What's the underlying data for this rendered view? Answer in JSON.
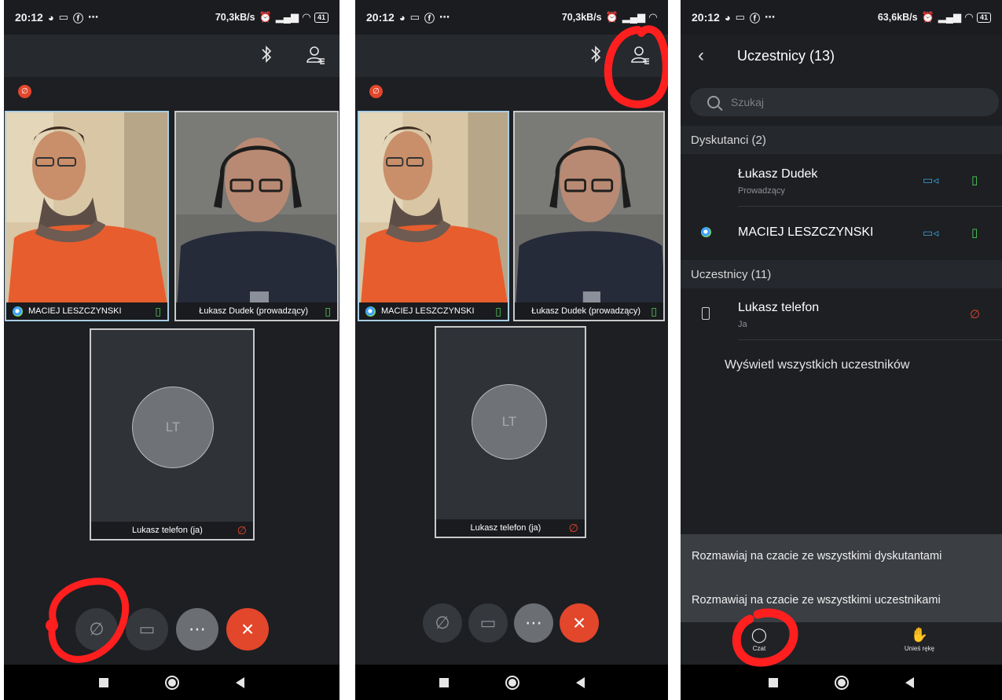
{
  "screens": [
    {
      "status": {
        "time": "20:12",
        "speed": "70,3kB/s",
        "battery": "41"
      },
      "tiles": [
        {
          "name": "MACIEJ LESZCZYNSKI"
        },
        {
          "name": "Łukasz Dudek (prowadzący)"
        },
        {
          "name": "Lukasz telefon (ja)",
          "initials": "LT"
        }
      ]
    },
    {
      "status": {
        "time": "20:12",
        "speed": "70,3kB/s",
        "battery": "41"
      },
      "tiles": [
        {
          "name": "MACIEJ LESZCZYNSKI"
        },
        {
          "name": "Łukasz Dudek (prowadzący)"
        },
        {
          "name": "Lukasz telefon (ja)",
          "initials": "LT"
        }
      ]
    },
    {
      "status": {
        "time": "20:12",
        "speed": "63,6kB/s",
        "battery": "41"
      },
      "title": "Uczestnicy (13)",
      "search_placeholder": "Szukaj",
      "section_panelists": "Dyskutanci (2)",
      "panelists": [
        {
          "name": "Łukasz Dudek",
          "role": "Prowadzący"
        },
        {
          "name": "MACIEJ LESZCZYNSKI"
        }
      ],
      "section_attendees": "Uczestnicy (11)",
      "attendees": [
        {
          "name": "Lukasz telefon",
          "role": "Ja"
        }
      ],
      "show_all": "Wyświetl wszystkich uczestników",
      "chat_options": [
        "Rozmawiaj na czacie ze wszystkimi dyskutantami",
        "Rozmawiaj na czacie ze wszystkimi uczestnikami"
      ],
      "tabs": {
        "chat": "Czat",
        "raise_hand": "Unieś rękę"
      }
    }
  ],
  "colors": {
    "accent_red": "#e2462b",
    "annotation": "#ff1f1f",
    "mic_green": "#4fcf5b",
    "camera_blue": "#3aa3e0"
  }
}
